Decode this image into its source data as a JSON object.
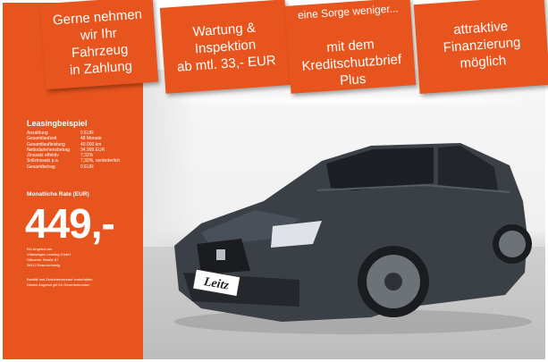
{
  "banners": {
    "b1": "Gerne nehmen\nwir Ihr\nFahrzeug\nin Zahlung",
    "b2": "Wartung &\nInspektion\nab mtl. 33,- EUR",
    "b3_line1": "eine Sorge weniger...",
    "b3_rest": "mit dem\nKreditschutzbrief\nPlus",
    "b4": "attraktive\nFinanzierung\nmöglich"
  },
  "lease": {
    "title": "Leasingbeispiel",
    "rows": [
      {
        "k": "Anzahlung",
        "v": "0 EUR"
      },
      {
        "k": "Gesamtlaufzeit",
        "v": "48 Monate"
      },
      {
        "k": "Gesamtlaufleistung",
        "v": "40.000 km"
      },
      {
        "k": "Nettodarlehensbetrag",
        "v": "34.999 EUR"
      },
      {
        "k": "Zinssatz effektiv",
        "v": "7,32%"
      },
      {
        "k": "Sollzinssatz p.a.",
        "v": "7,32%, veränderlich"
      },
      {
        "k": "Gesamtbetrag",
        "v": "0 EUR"
      }
    ],
    "rate_label": "Monatliche Rate (EUR)",
    "price": "449,-",
    "provider_lines": [
      "Ein Angebot der",
      "Volkswagen Leasing GmbH",
      "Gifhorner Straße 57",
      "38112 Braunschweig"
    ],
    "footnote_lines": [
      "Bonität und Zwischenverkauf vorbehalten.",
      "Dieses Angebot gilt für Gewerbekunden"
    ]
  },
  "plate_text": "Leitz",
  "colors": {
    "accent": "#e8541d",
    "car_body": "#3b4047"
  }
}
